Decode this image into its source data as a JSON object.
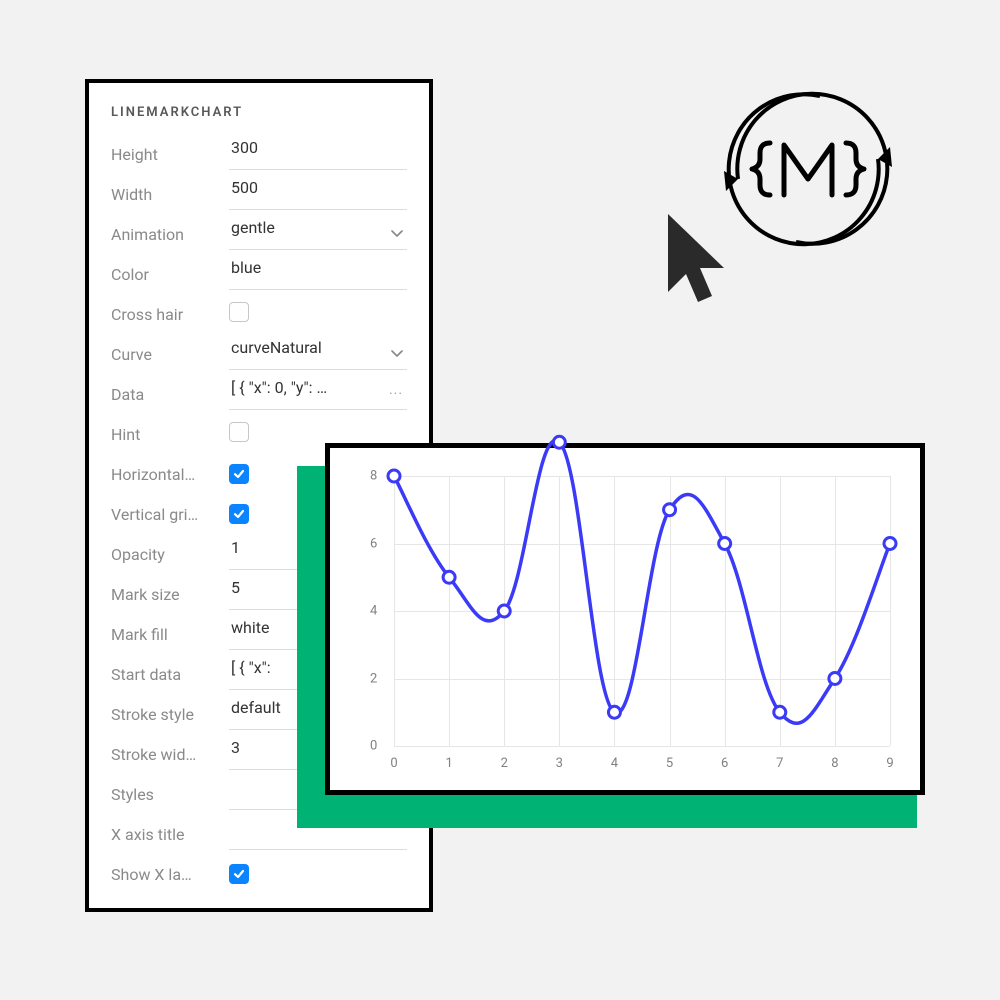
{
  "panel": {
    "title": "LINEMARKCHART",
    "rows": [
      {
        "key": "height",
        "label": "Height",
        "type": "text",
        "value": "300"
      },
      {
        "key": "width",
        "label": "Width",
        "type": "text",
        "value": "500"
      },
      {
        "key": "animation",
        "label": "Animation",
        "type": "select",
        "value": "gentle"
      },
      {
        "key": "color",
        "label": "Color",
        "type": "text",
        "value": "blue"
      },
      {
        "key": "crosshair",
        "label": "Cross hair",
        "type": "checkbox",
        "value": false
      },
      {
        "key": "curve",
        "label": "Curve",
        "type": "select",
        "value": "curveNatural"
      },
      {
        "key": "data",
        "label": "Data",
        "type": "code",
        "value": "[ { \"x\": 0, \"y\": …"
      },
      {
        "key": "hint",
        "label": "Hint",
        "type": "checkbox",
        "value": false
      },
      {
        "key": "hgrid",
        "label": "Horizontal…",
        "type": "checkbox",
        "value": true
      },
      {
        "key": "vgrid",
        "label": "Vertical gri…",
        "type": "checkbox",
        "value": true
      },
      {
        "key": "opacity",
        "label": "Opacity",
        "type": "text",
        "value": "1"
      },
      {
        "key": "marksize",
        "label": "Mark size",
        "type": "text",
        "value": "5"
      },
      {
        "key": "markfill",
        "label": "Mark fill",
        "type": "text",
        "value": "white"
      },
      {
        "key": "startdata",
        "label": "Start data",
        "type": "code",
        "value": "[ { \"x\":"
      },
      {
        "key": "strokestyl",
        "label": "Stroke style",
        "type": "text",
        "value": "default"
      },
      {
        "key": "strokewid",
        "label": "Stroke wid…",
        "type": "text",
        "value": "3"
      },
      {
        "key": "styles",
        "label": "Styles",
        "type": "text",
        "value": ""
      },
      {
        "key": "xtitle",
        "label": "X axis title",
        "type": "text",
        "value": ""
      },
      {
        "key": "showxla",
        "label": "Show X la…",
        "type": "checkbox",
        "value": true
      }
    ]
  },
  "chart_data": {
    "type": "line",
    "title": "",
    "xlabel": "",
    "ylabel": "",
    "x": [
      0,
      1,
      2,
      3,
      4,
      5,
      6,
      7,
      8,
      9
    ],
    "y": [
      8,
      5,
      4,
      9,
      1,
      7,
      6,
      1,
      2,
      6
    ],
    "xlim": [
      0,
      9
    ],
    "ylim": [
      0,
      8
    ],
    "x_ticks": [
      0,
      1,
      2,
      3,
      4,
      5,
      6,
      7,
      8,
      9
    ],
    "y_ticks": [
      0,
      2,
      4,
      6,
      8
    ],
    "grid": true,
    "mark_fill": "white",
    "stroke": "#3a3af7",
    "curve": "curveNatural"
  }
}
